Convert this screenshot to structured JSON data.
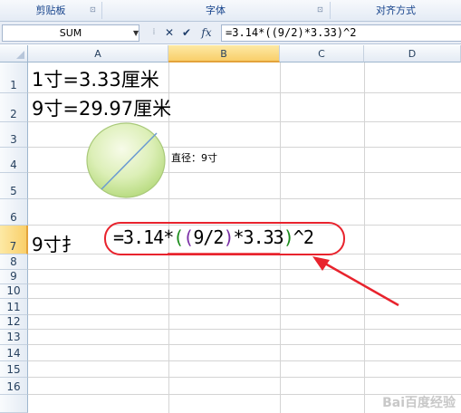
{
  "ribbon": {
    "groups": [
      "剪贴板",
      "字体",
      "对齐方式"
    ]
  },
  "formula_bar": {
    "name_box": "SUM",
    "cancel": "✕",
    "enter": "✔",
    "fx": "fx",
    "formula": "=3.14*((9/2)*3.33)^2"
  },
  "columns": [
    "A",
    "B",
    "C",
    "D"
  ],
  "rows": [
    "1",
    "2",
    "3",
    "4",
    "5",
    "6",
    "7",
    "8",
    "9",
    "10",
    "11",
    "12",
    "13",
    "14",
    "15",
    "16"
  ],
  "cells": {
    "a1": "1寸=3.33厘米",
    "a2": "9寸=29.97厘米",
    "c4": "直径：9寸",
    "a7": "9寸扌",
    "formula_parts": [
      "=3.14*",
      "(",
      "(",
      "9/2",
      ")",
      "*3.33",
      ")",
      "^2"
    ]
  },
  "watermark": "Bai百度经验",
  "colors": {
    "annotation_red": "#e8232d",
    "circle_green": "#c8e59a",
    "selected_header": "#f9cf6a"
  },
  "icons": [
    "launcher-icon",
    "cancel-icon",
    "enter-icon",
    "fx-icon",
    "dropdown-icon",
    "arrow-annotation-icon"
  ]
}
